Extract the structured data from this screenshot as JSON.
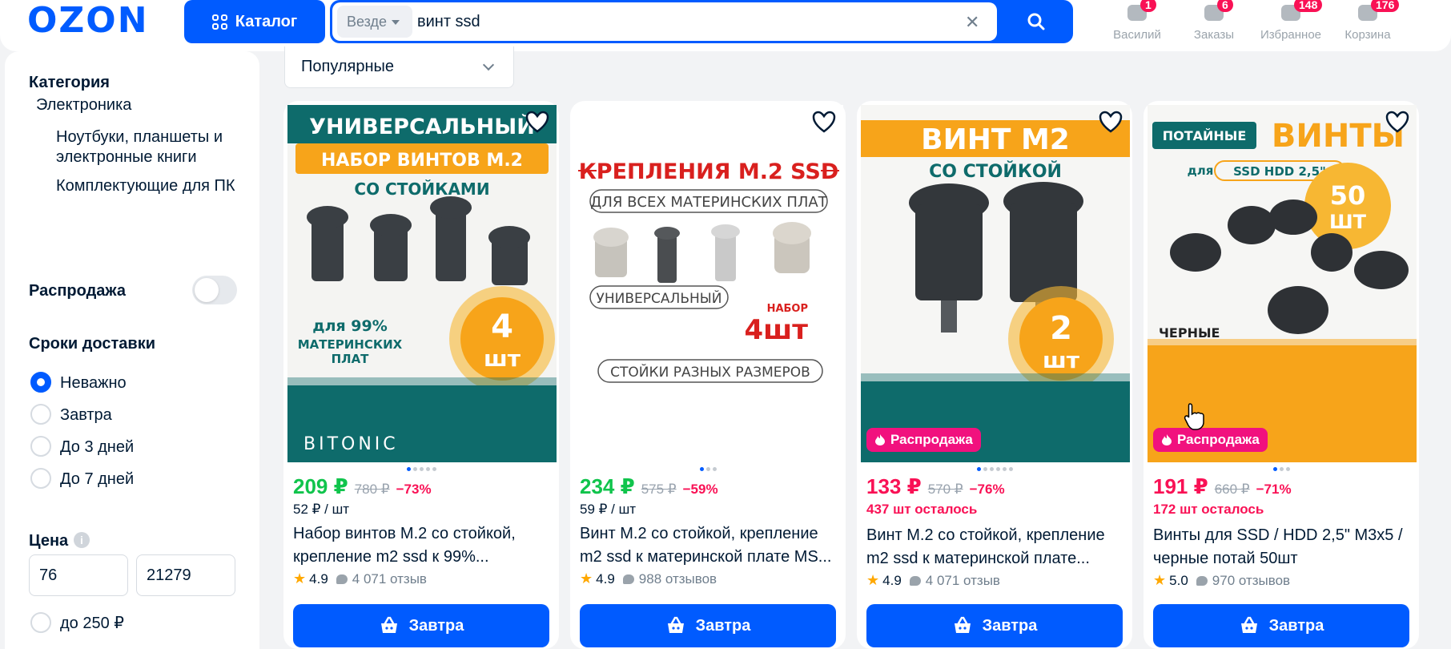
{
  "header": {
    "logo": "OZON",
    "catalog_label": "Каталог",
    "search": {
      "scope": "Везде",
      "value": "винт ssd"
    },
    "nav": [
      {
        "label": "Василий",
        "badge": "1",
        "icon": "user-icon"
      },
      {
        "label": "Заказы",
        "badge": "6",
        "icon": "box-icon"
      },
      {
        "label": "Избранное",
        "badge": "148",
        "icon": "heart-icon"
      },
      {
        "label": "Корзина",
        "badge": "176",
        "icon": "cart-icon"
      }
    ]
  },
  "sidebar": {
    "category_title": "Категория",
    "category_root": "Электроника",
    "subcategories": [
      "Ноутбуки, планшеты и электронные книги",
      "Комплектующие для ПК"
    ],
    "sale_label": "Распродажа",
    "delivery_title": "Сроки доставки",
    "delivery_options": [
      "Неважно",
      "Завтра",
      "До 3 дней",
      "До 7 дней"
    ],
    "price_title": "Цена",
    "price_from": "76",
    "price_to": "21279",
    "price_option": "до 250 ₽"
  },
  "sort": {
    "selected": "Популярные"
  },
  "products": [
    {
      "price": "209 ₽",
      "old_price": "780 ₽",
      "discount": "−73%",
      "unit_price": "52 ₽ / шт",
      "stock": "",
      "name": "Набор винтов M.2 со стойкой, крепление m2 ssd к 99%...",
      "rating": "4.9",
      "reviews": "4 071 отзыв",
      "buy_label": "Завтра",
      "image": {
        "line1": "УНИВЕРСАЛЬНЫЙ",
        "line2": "НАБОР ВИНТОВ M.2",
        "line3": "СО СТОЙКАМИ",
        "line4": "для 99%",
        "line5": "МАТЕРИНСКИХ",
        "line6": "ПЛАТ",
        "qty": "4",
        "qty_unit": "шт",
        "brand": "BITONIC"
      },
      "sale": ""
    },
    {
      "price": "234 ₽",
      "old_price": "575 ₽",
      "discount": "−59%",
      "unit_price": "59 ₽ / шт",
      "stock": "",
      "name": "Винт M.2 со стойкой, крепление m2 ssd к материнской плате MS...",
      "rating": "4.9",
      "reviews": "988 отзывов",
      "buy_label": "Завтра",
      "image": {
        "line1": "КРЕПЛЕНИЯ M.2 SSD",
        "line2": "ДЛЯ ВСЕХ МАТЕРИНСКИХ ПЛАТ",
        "line3": "УНИВЕРСАЛЬНЫЙ",
        "line4": "НАБОР",
        "qty": "4шт",
        "line5": "СТОЙКИ РАЗНЫХ РАЗМЕРОВ"
      },
      "sale": ""
    },
    {
      "price": "133 ₽",
      "old_price": "570 ₽",
      "discount": "−76%",
      "unit_price": "",
      "stock": "437 шт осталось",
      "name": "Винт M.2 со стойкой, крепление m2 ssd к материнской плате...",
      "rating": "4.9",
      "reviews": "4 071 отзыв",
      "buy_label": "Завтра",
      "image": {
        "line1": "ВИНТ M2",
        "line2": "СО СТОЙКОЙ",
        "qty": "2",
        "qty_unit": "шт"
      },
      "sale": "Распродажа"
    },
    {
      "price": "191 ₽",
      "old_price": "660 ₽",
      "discount": "−71%",
      "unit_price": "",
      "stock": "172 шт осталось",
      "name": "Винты для SSD / HDD 2,5\" M3x5 / черные потай 50шт",
      "rating": "5.0",
      "reviews": "970 отзывов",
      "buy_label": "Завтра",
      "image": {
        "line1": "ПОТАЙНЫЕ",
        "line2": "ВИНТЫ",
        "line3": "для",
        "line4": "SSD HDD 2,5\"",
        "qty": "50",
        "qty_unit": "ШТ",
        "line5": "ЧЕРНЫЕ"
      },
      "sale": "Распродажа"
    }
  ],
  "colors": {
    "brand": "#005bff",
    "sale": "#f91155",
    "price_green": "#10c44c",
    "price_pink": "#f91155"
  }
}
